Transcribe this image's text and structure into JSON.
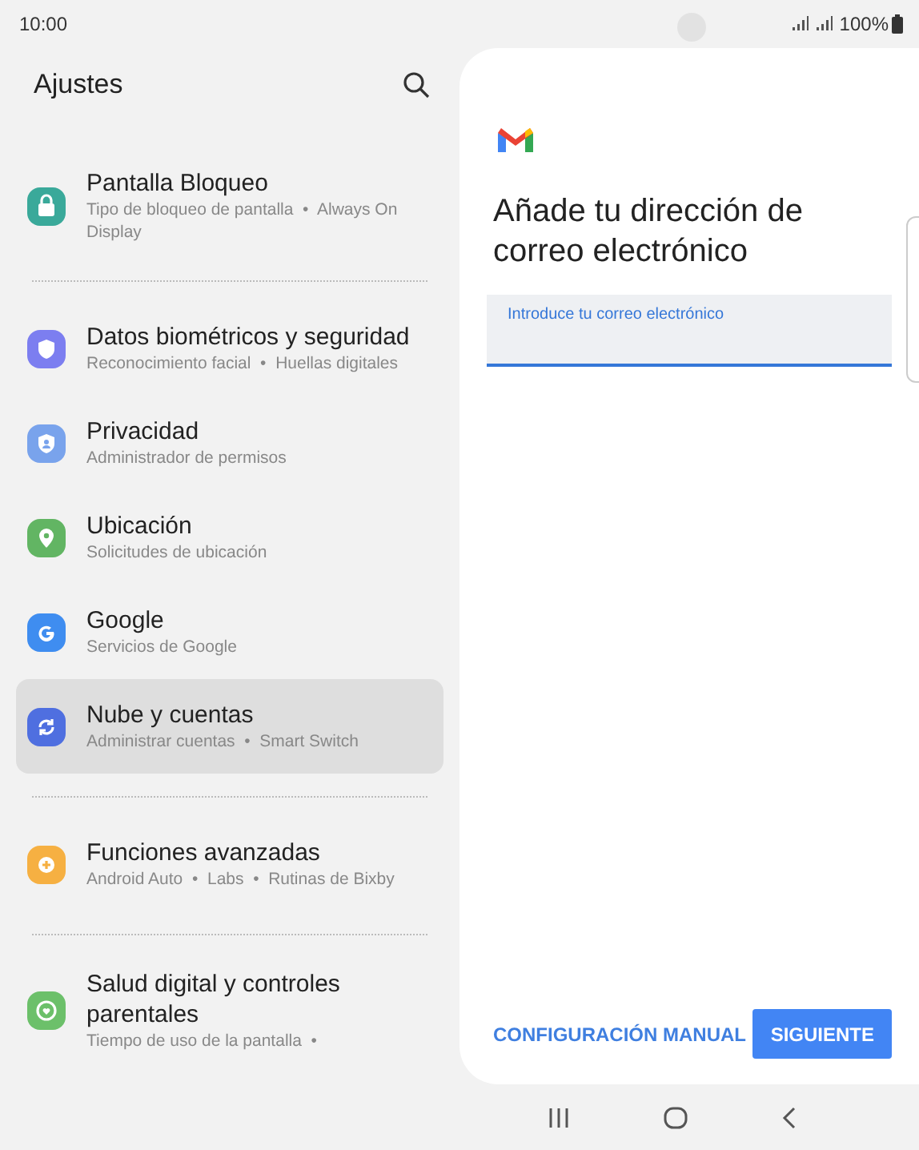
{
  "status_bar": {
    "time": "10:00",
    "battery": "100%"
  },
  "settings": {
    "title": "Ajustes",
    "groups": [
      {
        "items": [
          {
            "title": "Pantalla Bloqueo",
            "subtitle": "Tipo de bloqueo de pantalla  •  Always On Display",
            "color": "#3aa99a",
            "selected": false
          }
        ]
      },
      {
        "items": [
          {
            "title": "Datos biométricos y seguridad",
            "subtitle": "Reconocimiento facial  •  Huellas digitales",
            "color": "#7c7ef0",
            "selected": false
          },
          {
            "title": "Privacidad",
            "subtitle": "Administrador de permisos",
            "color": "#79a3ec",
            "selected": false
          },
          {
            "title": "Ubicación",
            "subtitle": "Solicitudes de ubicación",
            "color": "#62b563",
            "selected": false
          },
          {
            "title": "Google",
            "subtitle": "Servicios de Google",
            "color": "#3f8df0",
            "selected": false
          },
          {
            "title": "Nube y cuentas",
            "subtitle": "Administrar cuentas  •  Smart Switch",
            "color": "#4f6fe0",
            "selected": true
          }
        ]
      },
      {
        "items": [
          {
            "title": "Funciones avanzadas",
            "subtitle": "Android Auto  •  Labs  •  Rutinas de Bixby",
            "color": "#f6b042",
            "selected": false
          }
        ]
      },
      {
        "items": [
          {
            "title": "Salud digital y controles parentales",
            "subtitle": "Tiempo de uso de la pantalla  •",
            "color": "#6cc06a",
            "selected": false
          }
        ]
      }
    ]
  },
  "gmail": {
    "heading": "Añade tu dirección de correo electrónico",
    "email_field": {
      "label": "Introduce tu correo electrónico"
    },
    "buttons": [
      {
        "label": "CONFIGURACIÓN MANUAL",
        "kind": "text"
      },
      {
        "label": "SIGUIENTE",
        "kind": "filled"
      }
    ]
  }
}
